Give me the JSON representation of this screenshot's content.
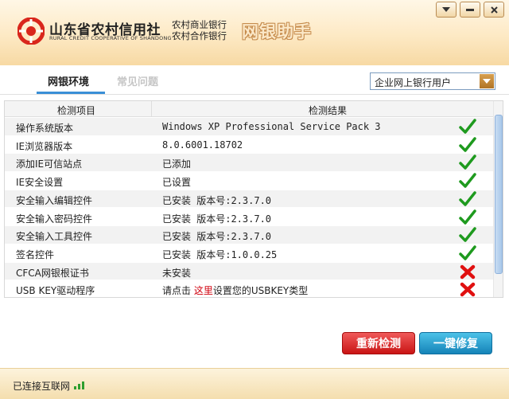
{
  "header": {
    "brand_cn": "山东省农村信用社",
    "brand_en": "RURAL CREDIT COOPERATIVE OF SHANDONG",
    "bank_line1": "农村商业银行",
    "bank_line2": "农村合作银行",
    "assistant": "网银助手"
  },
  "window_buttons": [
    "chevron-down-icon",
    "minimize-icon",
    "close-icon"
  ],
  "tabs": [
    {
      "label": "网银环境",
      "active": true
    },
    {
      "label": "常见问题",
      "active": false
    }
  ],
  "user_type": {
    "selected": "企业网上银行用户"
  },
  "table": {
    "headers": [
      "检测项目",
      "检测结果"
    ],
    "rows": [
      {
        "item": "操作系统版本",
        "result": "Windows XP Professional Service Pack 3",
        "status": "ok"
      },
      {
        "item": "IE浏览器版本",
        "result": "8.0.6001.18702",
        "status": "ok"
      },
      {
        "item": "添加IE可信站点",
        "result": "已添加",
        "status": "ok"
      },
      {
        "item": "IE安全设置",
        "result": "已设置",
        "status": "ok"
      },
      {
        "item": "安全输入编辑控件",
        "result": "已安装 版本号:2.3.7.0",
        "status": "ok"
      },
      {
        "item": "安全输入密码控件",
        "result": "已安装 版本号:2.3.7.0",
        "status": "ok"
      },
      {
        "item": "安全输入工具控件",
        "result": "已安装 版本号:2.3.7.0",
        "status": "ok"
      },
      {
        "item": "签名控件",
        "result": "已安装 版本号:1.0.0.25",
        "status": "ok"
      },
      {
        "item": "CFCA网银根证书",
        "result": "未安装",
        "status": "fail"
      },
      {
        "item": "USB KEY驱动程序",
        "result_prefix": "请点击 ",
        "result_link": "这里",
        "result_suffix": "设置您的USBKEY类型",
        "status": "fail"
      }
    ]
  },
  "buttons": {
    "recheck": "重新检测",
    "repair": "一键修复"
  },
  "status": {
    "connection": "已连接互联网"
  },
  "colors": {
    "ok": "#1e9a1e",
    "fail": "#e01010",
    "accent": "#3a8fd6"
  }
}
